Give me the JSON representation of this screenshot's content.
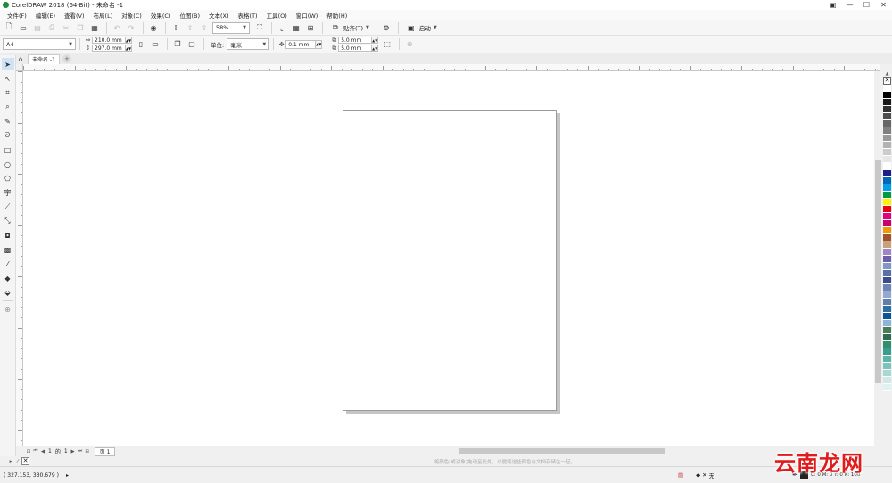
{
  "window": {
    "title": "CorelDRAW 2018 (64-Bit) - 未命名 -1"
  },
  "menu": [
    "文件(F)",
    "编辑(E)",
    "查看(V)",
    "布局(L)",
    "对象(C)",
    "效果(C)",
    "位图(B)",
    "文本(X)",
    "表格(T)",
    "工具(O)",
    "窗口(W)",
    "帮助(H)"
  ],
  "standard_toolbar": {
    "zoom_value": "58%",
    "snap_label": "贴齐(T)",
    "launch_label": "启动"
  },
  "property_bar": {
    "page_size": "A4",
    "width": "210.0 mm",
    "height": "297.0 mm",
    "units_label": "单位:",
    "units_value": "毫米",
    "nudge": "0.1 mm",
    "dup_x": "5.0 mm",
    "dup_y": "5.0 mm"
  },
  "document_tab": "未命名 -1",
  "page_nav": {
    "current": "1",
    "of": "的",
    "total": "1",
    "page_tab": "页 1"
  },
  "document_palette_hint": "将颜色(或对象)拖动至此处，以便将这些颜色与文档存储在一起。",
  "status": {
    "coordinates": "( 327.153, 330.679 )",
    "fill_none": "无",
    "outline_info": "C: 0 M: 0 Y: 0 K: 100"
  },
  "watermark": "云南龙网",
  "palette_colors": [
    "#ffffff",
    "#000000",
    "#1a1a1a",
    "#333333",
    "#4d4d4d",
    "#666666",
    "#808080",
    "#999999",
    "#b3b3b3",
    "#cccccc",
    "#e6e6e6",
    "#ffffff",
    "#1d2088",
    "#0068b7",
    "#00a0e9",
    "#009944",
    "#fff100",
    "#e60012",
    "#e4007f",
    "#c8006e",
    "#f39800",
    "#a0522d",
    "#c7a27c",
    "#9e86c8",
    "#6d5dab",
    "#8097c7",
    "#5b6ea8",
    "#3a4b8a",
    "#6d84b4",
    "#94a8d0",
    "#5f7fa8",
    "#2d6fa3",
    "#0b5394",
    "#8fb5d6",
    "#4a7c59",
    "#2e6b4f",
    "#2f8f6f",
    "#3a9e8e",
    "#5fb3a8",
    "#7bc4ba",
    "#a7d8d2",
    "#cfeae6",
    "#e0f2f0"
  ]
}
